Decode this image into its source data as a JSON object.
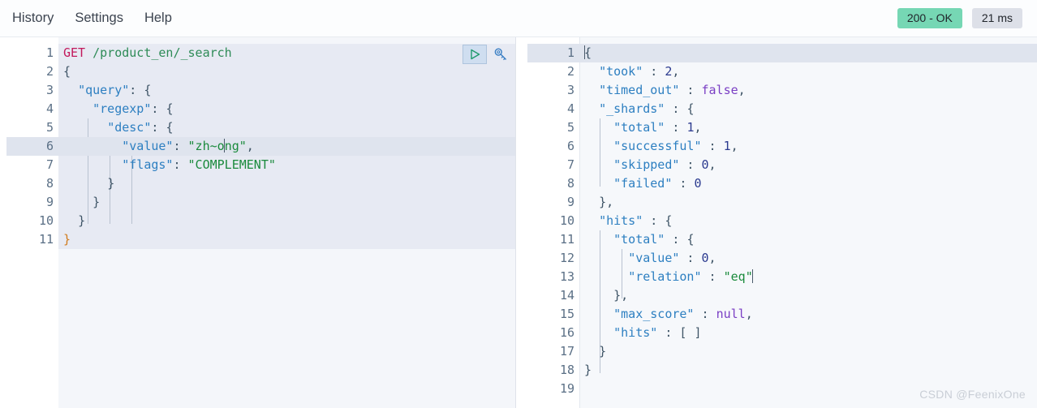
{
  "menu": {
    "items": [
      {
        "label": "History",
        "name": "menu-item-history"
      },
      {
        "label": "Settings",
        "name": "menu-item-settings"
      },
      {
        "label": "Help",
        "name": "menu-item-help"
      }
    ]
  },
  "status": {
    "code_label": "200 - OK",
    "time_label": "21 ms",
    "ok_color": "#76d7b4",
    "time_color": "#dde0e8"
  },
  "toolbar": {
    "run_icon": "play-triangle-icon",
    "wrench_icon": "wrench-icon"
  },
  "request_editor": {
    "name": "request-editor",
    "line_numbers": [
      "1",
      "2",
      "3",
      "4",
      "5",
      "6",
      "7",
      "8",
      "9",
      "10",
      "11"
    ],
    "active_line": 6,
    "folds": {
      "2": "down",
      "3": "down",
      "4": "down",
      "5": "down",
      "8": "up",
      "9": "up",
      "10": "up",
      "11": "up"
    },
    "lines": [
      {
        "n": 1,
        "text": "GET /product_en/_search"
      },
      {
        "n": 2,
        "text": "{"
      },
      {
        "n": 3,
        "text": "  \"query\": {"
      },
      {
        "n": 4,
        "text": "    \"regexp\": {"
      },
      {
        "n": 5,
        "text": "      \"desc\": {"
      },
      {
        "n": 6,
        "text": "        \"value\": \"zh~ong\","
      },
      {
        "n": 7,
        "text": "        \"flags\": \"COMPLEMENT\""
      },
      {
        "n": 8,
        "text": "      }"
      },
      {
        "n": 9,
        "text": "    }"
      },
      {
        "n": 10,
        "text": "  }"
      },
      {
        "n": 11,
        "text": "}"
      }
    ],
    "method": "GET",
    "path": "/product_en/_search"
  },
  "response_viewer": {
    "name": "response-viewer",
    "line_numbers": [
      "1",
      "2",
      "3",
      "4",
      "5",
      "6",
      "7",
      "8",
      "9",
      "10",
      "11",
      "12",
      "13",
      "14",
      "15",
      "16",
      "17",
      "18",
      "19"
    ],
    "active_line": 1,
    "folds": {
      "1": "down",
      "4": "down",
      "9": "up",
      "10": "down",
      "11": "down",
      "14": "up",
      "17": "up",
      "18": "up"
    },
    "lines": [
      {
        "n": 1,
        "text": "{"
      },
      {
        "n": 2,
        "text": "  \"took\" : 2,"
      },
      {
        "n": 3,
        "text": "  \"timed_out\" : false,"
      },
      {
        "n": 4,
        "text": "  \"_shards\" : {"
      },
      {
        "n": 5,
        "text": "    \"total\" : 1,"
      },
      {
        "n": 6,
        "text": "    \"successful\" : 1,"
      },
      {
        "n": 7,
        "text": "    \"skipped\" : 0,"
      },
      {
        "n": 8,
        "text": "    \"failed\" : 0"
      },
      {
        "n": 9,
        "text": "  },"
      },
      {
        "n": 10,
        "text": "  \"hits\" : {"
      },
      {
        "n": 11,
        "text": "    \"total\" : {"
      },
      {
        "n": 12,
        "text": "      \"value\" : 0,"
      },
      {
        "n": 13,
        "text": "      \"relation\" : \"eq\""
      },
      {
        "n": 14,
        "text": "    },"
      },
      {
        "n": 15,
        "text": "    \"max_score\" : null,"
      },
      {
        "n": 16,
        "text": "    \"hits\" : [ ]"
      },
      {
        "n": 17,
        "text": "  }"
      },
      {
        "n": 18,
        "text": "}"
      },
      {
        "n": 19,
        "text": ""
      }
    ],
    "values": {
      "took": "2",
      "timed_out": "false",
      "shards_total": "1",
      "shards_successful": "1",
      "shards_skipped": "0",
      "shards_failed": "0",
      "hits_total_value": "0",
      "hits_total_relation": "eq",
      "max_score": "null",
      "hits_array": "[ ]"
    }
  },
  "watermark": {
    "text": "CSDN @FeenixOne"
  }
}
